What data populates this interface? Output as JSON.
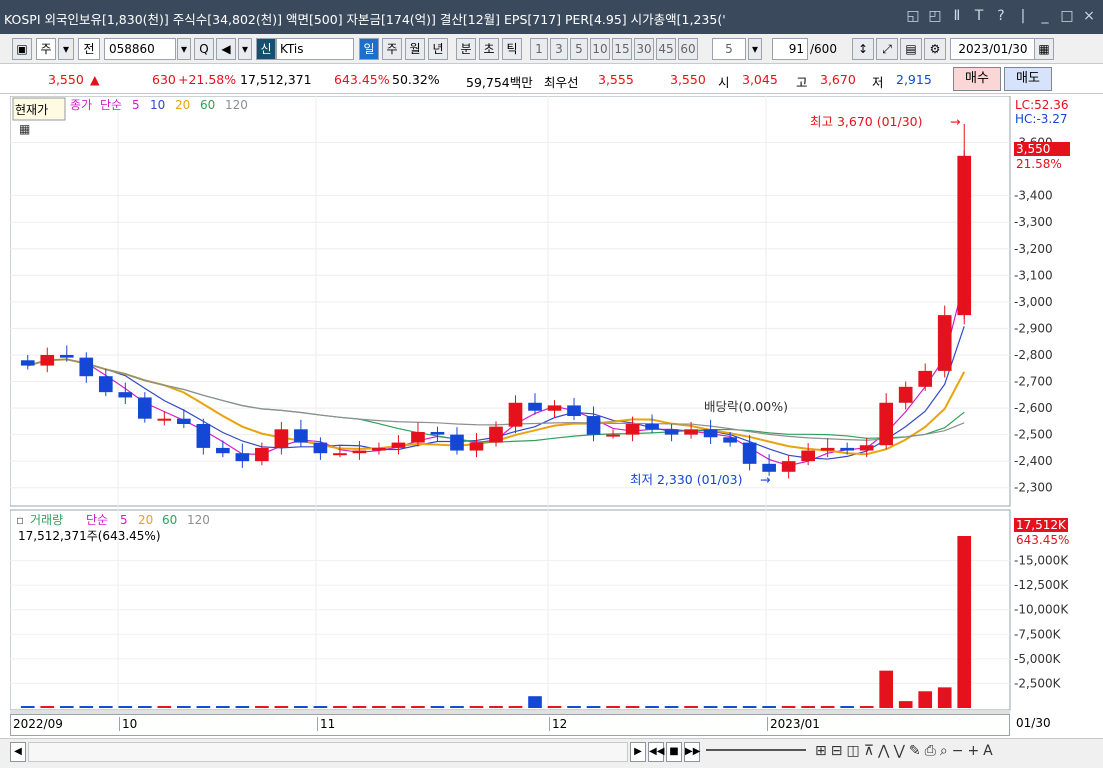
{
  "titlebar": {
    "text": "KOSPI 외국인보유[1,830(천)] 주식수[34,802(천)] 액면[500] 자본금[174(억)] 결산[12월] EPS[717] PER[4.95] 시가총액[1,235('",
    "controls": [
      "◱",
      "◰",
      "Ⅱ",
      "T",
      "?",
      "|",
      "_",
      "□",
      "×"
    ]
  },
  "toolbar": {
    "period": "주",
    "prev": "전",
    "code": "058860",
    "search_icon": "Q",
    "sound_icon": "◀",
    "new_badge": "신",
    "stock_name": "KTis",
    "periods": [
      "일",
      "주",
      "월",
      "년",
      "분",
      "초",
      "틱"
    ],
    "intervals": [
      "1",
      "3",
      "5",
      "10",
      "15",
      "30",
      "45",
      "60"
    ],
    "interval_value": "5",
    "count": "91",
    "count_max": "/600",
    "date": "2023/01/30"
  },
  "quote": {
    "price": "3,550",
    "change_arrow": "▲",
    "change": "630",
    "change_rate": "+21.58%",
    "volume": "17,512,371",
    "volume_rate": "643.45%",
    "turnover": "50.32%",
    "amount": "59,754백만",
    "best_label": "최우선",
    "best_ask": "3,555",
    "best_bid": "3,550",
    "open_label": "시",
    "open": "3,045",
    "high_label": "고",
    "high": "3,670",
    "low_label": "저",
    "low": "2,915",
    "buy": "매수",
    "sell": "매도"
  },
  "chart": {
    "price_legend": {
      "label1": "종가",
      "label2": "단순",
      "ma": [
        "5",
        "10",
        "20",
        "60",
        "120"
      ]
    },
    "overlay_label": "현재가",
    "lc": "LC:52.36",
    "hc": "HC:-3.27",
    "price_ticks": [
      "3,600",
      "3,400",
      "3,300",
      "3,200",
      "3,100",
      "3,000",
      "2,900",
      "2,800",
      "2,700",
      "2,600",
      "2,500",
      "2,400",
      "2,300"
    ],
    "current_price_tag": "3,550",
    "current_rate_tag": "21.58%",
    "high_annotation": "최고 3,670 (01/30)",
    "low_annotation": "최저 2,330 (01/03)",
    "dividend_label": "배당락(0.00%)",
    "volume_legend": {
      "label1": "거래량",
      "label2": "단순",
      "ma": [
        "5",
        "20",
        "60",
        "120"
      ]
    },
    "volume_info": "17,512,371주(643.45%)",
    "volume_tag": "17,512K",
    "volume_rate_tag": "643.45%",
    "volume_ticks": [
      "15,000K",
      "12,500K",
      "10,000K",
      "7,500K",
      "5,000K",
      "2,500K"
    ],
    "x_labels": [
      "2022/09",
      "10",
      "11",
      "12",
      "2023/01"
    ],
    "x_right_label": "01/30",
    "colors": {
      "up": "#e5111c",
      "down": "#1447d6",
      "ma5": "#d020c8",
      "ma10": "#3148c9",
      "ma20": "#e8a40e",
      "ma60": "#2ea25a",
      "ma120": "#8f8f8f"
    }
  },
  "chart_data": {
    "type": "candlestick",
    "period": "daily",
    "start": "2022/09/01",
    "end": "2023/01/30",
    "series_ohlc_close_approx": [
      2760,
      2800,
      2790,
      2720,
      2660,
      2640,
      2560,
      2560,
      2540,
      2450,
      2430,
      2400,
      2450,
      2520,
      2470,
      2430,
      2430,
      2440,
      2450,
      2470,
      2510,
      2500,
      2440,
      2470,
      2530,
      2620,
      2590,
      2610,
      2570,
      2500,
      2500,
      2540,
      2520,
      2500,
      2520,
      2490,
      2470,
      2390,
      2360,
      2400,
      2440,
      2450,
      2440,
      2460,
      2620,
      2680,
      2740,
      2950,
      3550
    ],
    "high": 3670,
    "high_date": "01/30",
    "low": 2330,
    "low_date": "01/03",
    "ylim": [
      2250,
      3700
    ],
    "last_volume": 17512371
  }
}
